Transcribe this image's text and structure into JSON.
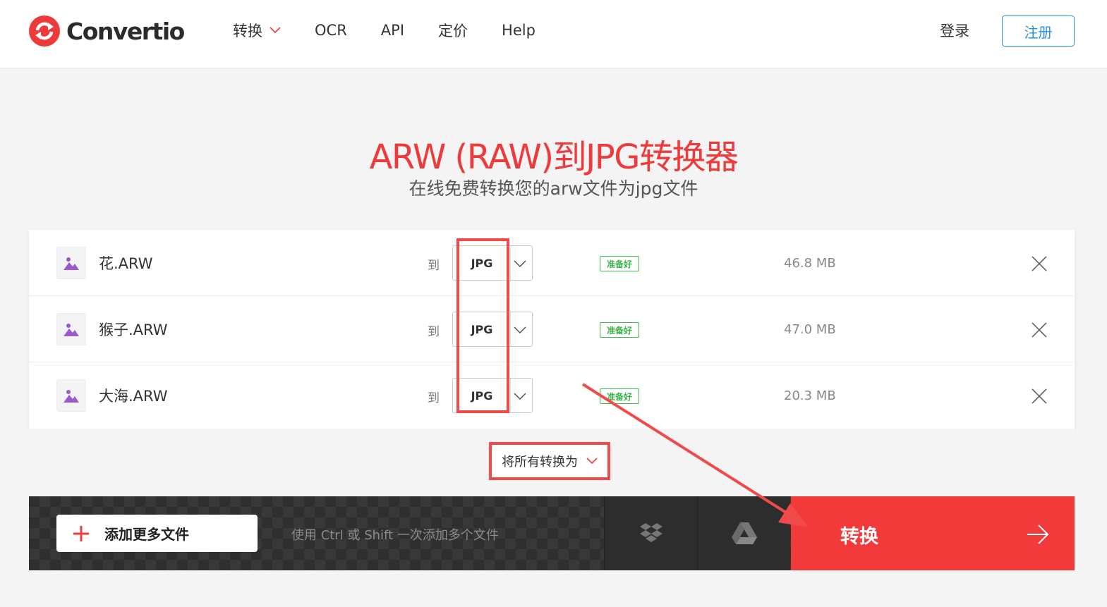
{
  "header": {
    "logo_text": "Convertio",
    "nav": [
      {
        "label": "转换",
        "has_dropdown": true
      },
      {
        "label": "OCR"
      },
      {
        "label": "API"
      },
      {
        "label": "定价"
      },
      {
        "label": "Help"
      }
    ],
    "login": "登录",
    "signup": "注册"
  },
  "hero": {
    "title": "ARW (RAW)到JPG转换器",
    "subtitle": "在线免费转换您的arw文件为jpg文件"
  },
  "files": [
    {
      "name": "花.ARW",
      "to": "到",
      "format": "JPG",
      "status": "准备好",
      "size": "46.8 MB"
    },
    {
      "name": "猴子.ARW",
      "to": "到",
      "format": "JPG",
      "status": "准备好",
      "size": "47.0 MB"
    },
    {
      "name": "大海.ARW",
      "to": "到",
      "format": "JPG",
      "status": "准备好",
      "size": "20.3 MB"
    }
  ],
  "convert_all": "将所有转换为",
  "bottom": {
    "add_more": "添加更多文件",
    "hint": "使用 Ctrl 或 Shift 一次添加多个文件",
    "dropbox_icon": "dropbox-icon",
    "gdrive_icon": "google-drive-icon",
    "convert": "转换"
  },
  "colors": {
    "brand_red": "#f23a3a",
    "title_red": "#ee3a3a",
    "link_blue": "#2a93e0",
    "ready_green": "#3cb54a",
    "annotation_red": "#f04a4a"
  }
}
